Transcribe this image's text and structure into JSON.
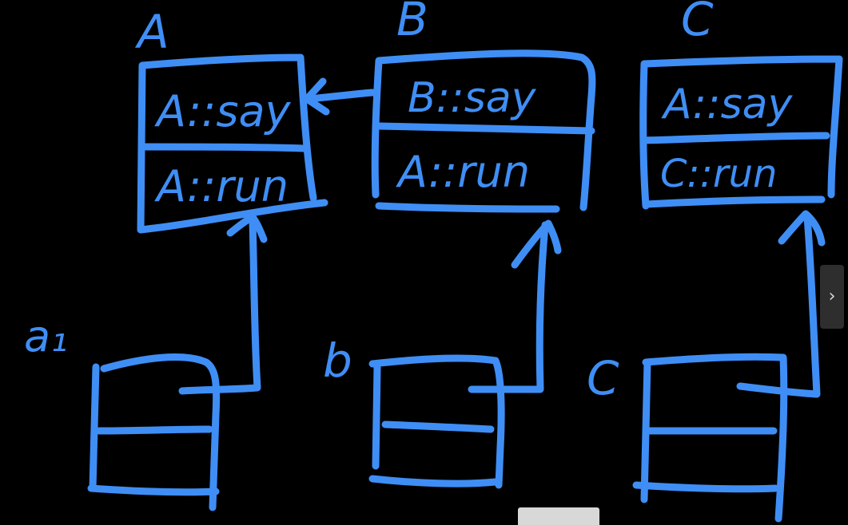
{
  "colors": {
    "background": "#000000",
    "ink": "#3f8ef5"
  },
  "classes": [
    {
      "name": "A",
      "methods": [
        "A::say",
        "A::run"
      ]
    },
    {
      "name": "B",
      "methods": [
        "B::say",
        "A::run"
      ]
    },
    {
      "name": "C",
      "methods": [
        "A::say",
        "C::run"
      ]
    }
  ],
  "objects": [
    {
      "name": "a₁",
      "points_to": "A"
    },
    {
      "name": "b",
      "points_to": "B"
    },
    {
      "name": "C",
      "points_to": "C"
    }
  ],
  "inheritance": {
    "from": "B",
    "to": "A"
  },
  "controls": {
    "next_icon": "chevron-right-icon",
    "next_glyph": "›"
  },
  "watermark": {
    "text": ""
  }
}
